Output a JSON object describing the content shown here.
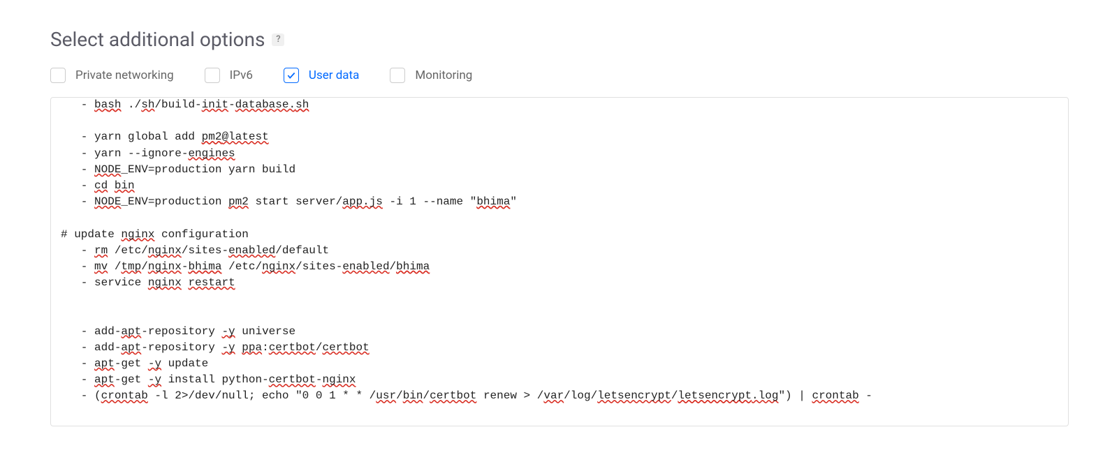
{
  "section": {
    "title": "Select additional options",
    "help_tooltip": "?"
  },
  "options": [
    {
      "id": "private-networking",
      "label": "Private networking",
      "checked": false
    },
    {
      "id": "ipv6",
      "label": "IPv6",
      "checked": false
    },
    {
      "id": "user-data",
      "label": "User data",
      "checked": true
    },
    {
      "id": "monitoring",
      "label": "Monitoring",
      "checked": false
    }
  ],
  "user_data_script": "   - bash ./sh/build-init-database.sh\n\n   - yarn global add pm2@latest\n   - yarn --ignore-engines\n   - NODE_ENV=production yarn build\n   - cd bin\n   - NODE_ENV=production pm2 start server/app.js -i 1 --name \"bhima\"\n\n# update nginx configuration\n   - rm /etc/nginx/sites-enabled/default\n   - mv /tmp/nginx-bhima /etc/nginx/sites-enabled/bhima\n   - service nginx restart\n\n\n   - add-apt-repository -y universe\n   - add-apt-repository -y ppa:certbot/certbot\n   - apt-get -y update\n   - apt-get -y install python-certbot-nginx\n   - (crontab -l 2>/dev/null; echo \"0 0 1 * * /usr/bin/certbot renew > /var/log/letsencrypt/letsencrypt.log\") | crontab -",
  "spellcheck_tokens": [
    "bash",
    "sh",
    "init",
    "database.sh",
    "pm2@latest",
    "engines",
    "NODE",
    "cd",
    "bin",
    "pm2",
    "app.js",
    "bhima",
    "nginx",
    "rm",
    "enabled",
    "mv",
    "tmp",
    "bhima",
    "restart",
    "apt",
    "-y",
    "ppa",
    "certbot",
    "usr",
    "var",
    "letsencrypt",
    "letsencrypt.log",
    "crontab"
  ]
}
